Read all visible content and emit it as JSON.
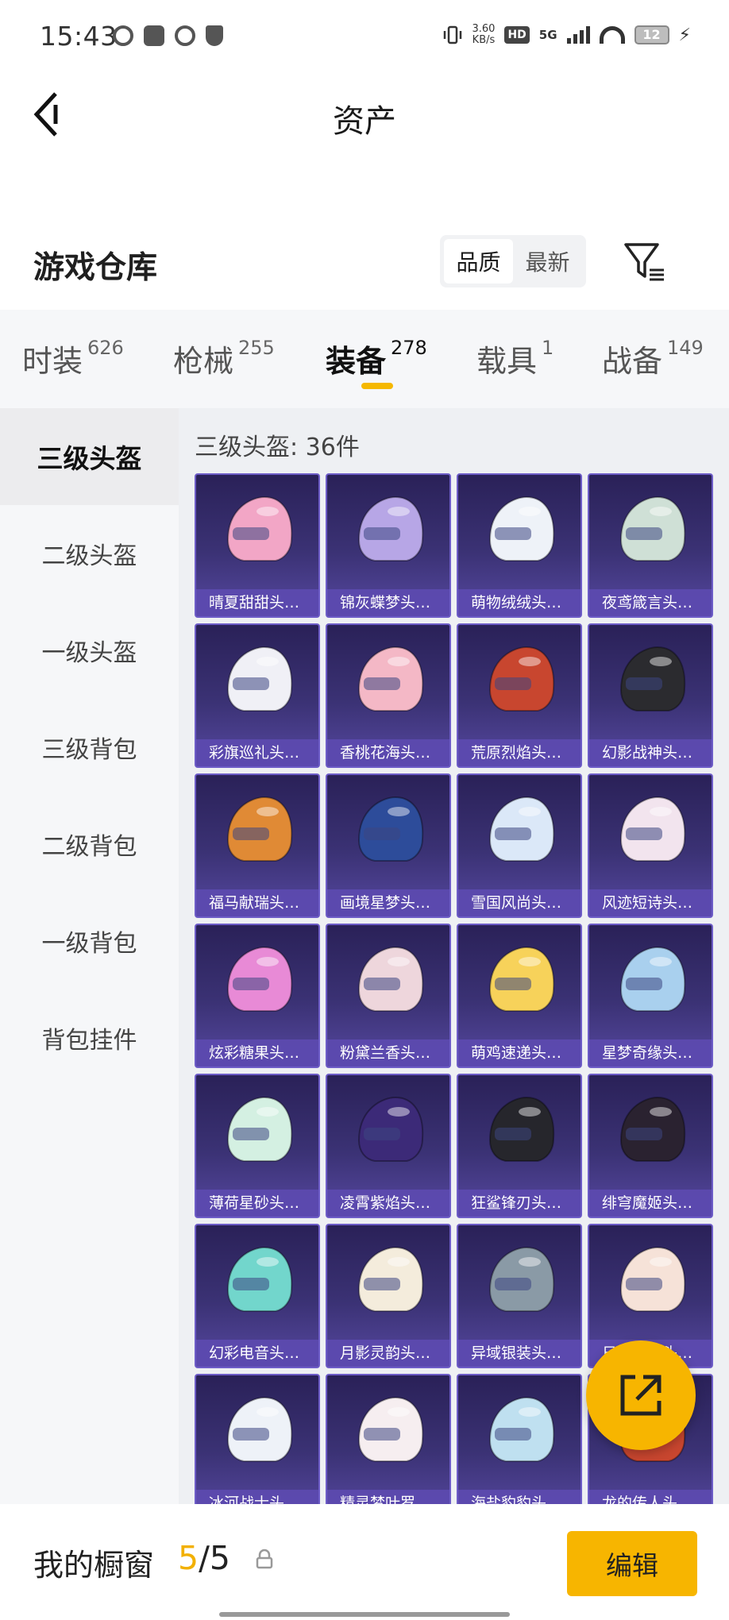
{
  "status_bar": {
    "time": "15:43",
    "net_speed_value": "3.60",
    "net_speed_unit": "KB/s",
    "hd_label": "HD",
    "network": "5G",
    "battery": "12",
    "icons": [
      "sync-icon",
      "message-icon",
      "wechat-icon",
      "shield-icon",
      "vibrate-icon",
      "signal-icon",
      "wifi-icon",
      "battery-icon",
      "charging-icon"
    ]
  },
  "header": {
    "title": "资产",
    "back_icon": "chevron-left-icon"
  },
  "warehouse": {
    "title": "游戏仓库",
    "sort_options": [
      {
        "label": "品质",
        "active": true
      },
      {
        "label": "最新",
        "active": false
      }
    ],
    "filter_icon": "filter-icon"
  },
  "categories": [
    {
      "name": "时装",
      "count": "626",
      "active": false
    },
    {
      "name": "枪械",
      "count": "255",
      "active": false
    },
    {
      "name": "装备",
      "count": "278",
      "active": true
    },
    {
      "name": "载具",
      "count": "1",
      "active": false
    },
    {
      "name": "战备",
      "count": "149",
      "active": false
    }
  ],
  "sidebar": {
    "items": [
      {
        "label": "三级头盔",
        "active": true
      },
      {
        "label": "二级头盔",
        "active": false
      },
      {
        "label": "一级头盔",
        "active": false
      },
      {
        "label": "三级背包",
        "active": false
      },
      {
        "label": "二级背包",
        "active": false
      },
      {
        "label": "一级背包",
        "active": false
      },
      {
        "label": "背包挂件",
        "active": false
      }
    ]
  },
  "content": {
    "heading": "三级头盔: 36件",
    "items": [
      {
        "name": "晴夏甜甜头…",
        "color": "#f2a6c6"
      },
      {
        "name": "锦灰蝶梦头…",
        "color": "#b7a6e6"
      },
      {
        "name": "萌物绒绒头…",
        "color": "#eef2f8"
      },
      {
        "name": "夜鸢箴言头…",
        "color": "#cfe0d6"
      },
      {
        "name": "彩旗巡礼头…",
        "color": "#f0f0f6"
      },
      {
        "name": "香桃花海头…",
        "color": "#f4b8c6"
      },
      {
        "name": "荒原烈焰头…",
        "color": "#c8462f"
      },
      {
        "name": "幻影战神头…",
        "color": "#2b2b2f"
      },
      {
        "name": "福马献瑞头…",
        "color": "#e08a35"
      },
      {
        "name": "画境星梦头…",
        "color": "#2d4c9a"
      },
      {
        "name": "雪国风尚头…",
        "color": "#dbe8f8"
      },
      {
        "name": "风迹短诗头…",
        "color": "#f2e4ee"
      },
      {
        "name": "炫彩糖果头…",
        "color": "#e88ad6"
      },
      {
        "name": "粉黛兰香头…",
        "color": "#eed6dc"
      },
      {
        "name": "萌鸡速递头…",
        "color": "#f7d25a"
      },
      {
        "name": "星梦奇缘头…",
        "color": "#a9d0ee"
      },
      {
        "name": "薄荷星砂头…",
        "color": "#d4f0e2"
      },
      {
        "name": "凌霄紫焰头…",
        "color": "#3c2a78"
      },
      {
        "name": "狂鲨锋刃头…",
        "color": "#26262c"
      },
      {
        "name": "绯穹魔姬头…",
        "color": "#2a2230"
      },
      {
        "name": "幻彩电音头…",
        "color": "#72d6cc"
      },
      {
        "name": "月影灵韵头…",
        "color": "#f4ecdc"
      },
      {
        "name": "异域银装头…",
        "color": "#8a9aa6"
      },
      {
        "name": "日月…音头…",
        "color": "#f6e2d8"
      },
      {
        "name": "冰河战士头…",
        "color": "#eef2f8"
      },
      {
        "name": "精灵梦叶罗…",
        "color": "#f6eef0"
      },
      {
        "name": "海盐豹豹头…",
        "color": "#bfe0f0"
      },
      {
        "name": "龙的传人头…",
        "color": "#c8462f"
      }
    ]
  },
  "fab": {
    "icon": "share-icon",
    "color": "#f7b500"
  },
  "bottom_bar": {
    "label": "我的橱窗",
    "current": "5",
    "separator": "/",
    "total": "5",
    "lock_icon": "lock-icon",
    "edit_label": "编辑"
  },
  "colors": {
    "accent": "#f7b500",
    "card_bg": "#3b3275",
    "card_label_bg": "#5c4ab0"
  }
}
